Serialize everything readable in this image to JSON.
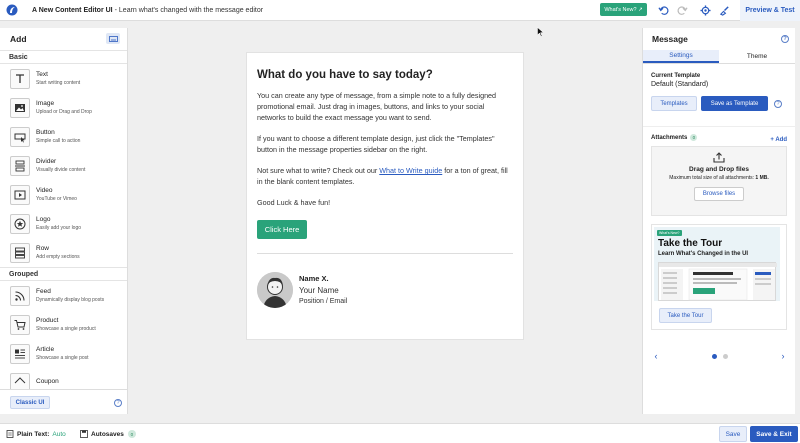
{
  "topbar": {
    "title": "A New Content Editor UI",
    "subtitle": "- Learn what's changed with the message editor",
    "whats_new": "What's New?",
    "preview_label": "Preview & Test"
  },
  "left_panel": {
    "title": "Add",
    "basic_label": "Basic",
    "grouped_label": "Grouped",
    "basic_blocks": [
      {
        "title": "Text",
        "desc": "Start writing content",
        "icon": "text-icon"
      },
      {
        "title": "Image",
        "desc": "Upload or Drag and Drop",
        "icon": "image-icon"
      },
      {
        "title": "Button",
        "desc": "Simple call to action",
        "icon": "button-icon"
      },
      {
        "title": "Divider",
        "desc": "Visually divide content",
        "icon": "divider-icon"
      },
      {
        "title": "Video",
        "desc": "YouTube or Vimeo",
        "icon": "video-icon"
      },
      {
        "title": "Logo",
        "desc": "Easily add your logo",
        "icon": "logo-icon"
      },
      {
        "title": "Row",
        "desc": "Add empty sections",
        "icon": "row-icon"
      }
    ],
    "grouped_blocks": [
      {
        "title": "Feed",
        "desc": "Dynamically display blog posts",
        "icon": "feed-icon"
      },
      {
        "title": "Product",
        "desc": "Showcase a single product",
        "icon": "cart-icon"
      },
      {
        "title": "Article",
        "desc": "Showcase a single post",
        "icon": "article-icon"
      },
      {
        "title": "Coupon",
        "desc": "",
        "icon": "coupon-icon"
      }
    ],
    "classic_ui": "Classic UI"
  },
  "email": {
    "heading": "What do you have to say today?",
    "p1": "You can create any type of message, from a simple note to a fully designed promotional email. Just drag in images, buttons, and links to your social networks to build the exact message you want to send.",
    "p2": "If you want to choose a different template design, just click the \"Templates\" button in the message properties sidebar on the right.",
    "p3_before": "Not sure what to write? Check out our ",
    "p3_link": "What to Write guide",
    "p3_after": " for a ton of great, fill in the blank content templates.",
    "p4": "Good Luck & have fun!",
    "button": "Click Here",
    "sig_name": "Name X.",
    "sig_your_name": "Your Name",
    "sig_position": "Position / Email"
  },
  "right_panel": {
    "title": "Message",
    "tabs": [
      "Settings",
      "Theme"
    ],
    "current_template_label": "Current Template",
    "current_template_value": "Default (Standard)",
    "templates_btn": "Templates",
    "save_template_btn": "Save as Template",
    "attachments_label": "Attachments",
    "attachments_count": "0",
    "add_label": "+ Add",
    "drop_title": "Drag and Drop files",
    "drop_sub_pre": "Maximum total size of all attachments: ",
    "drop_sub_size": "1 MB.",
    "browse_btn": "Browse files",
    "tour_tag": "What's New?",
    "tour_title": "Take the Tour",
    "tour_sub": "Learn What's Changed in the UI",
    "tour_btn": "Take the Tour"
  },
  "bottombar": {
    "plain_text_label": "Plain Text:",
    "plain_text_value": "Auto",
    "autosaves_label": "Autosaves",
    "autosaves_count": "0",
    "save": "Save",
    "save_exit": "Save & Exit"
  },
  "colors": {
    "accent": "#2a5bbf",
    "green": "#2aa37a"
  }
}
